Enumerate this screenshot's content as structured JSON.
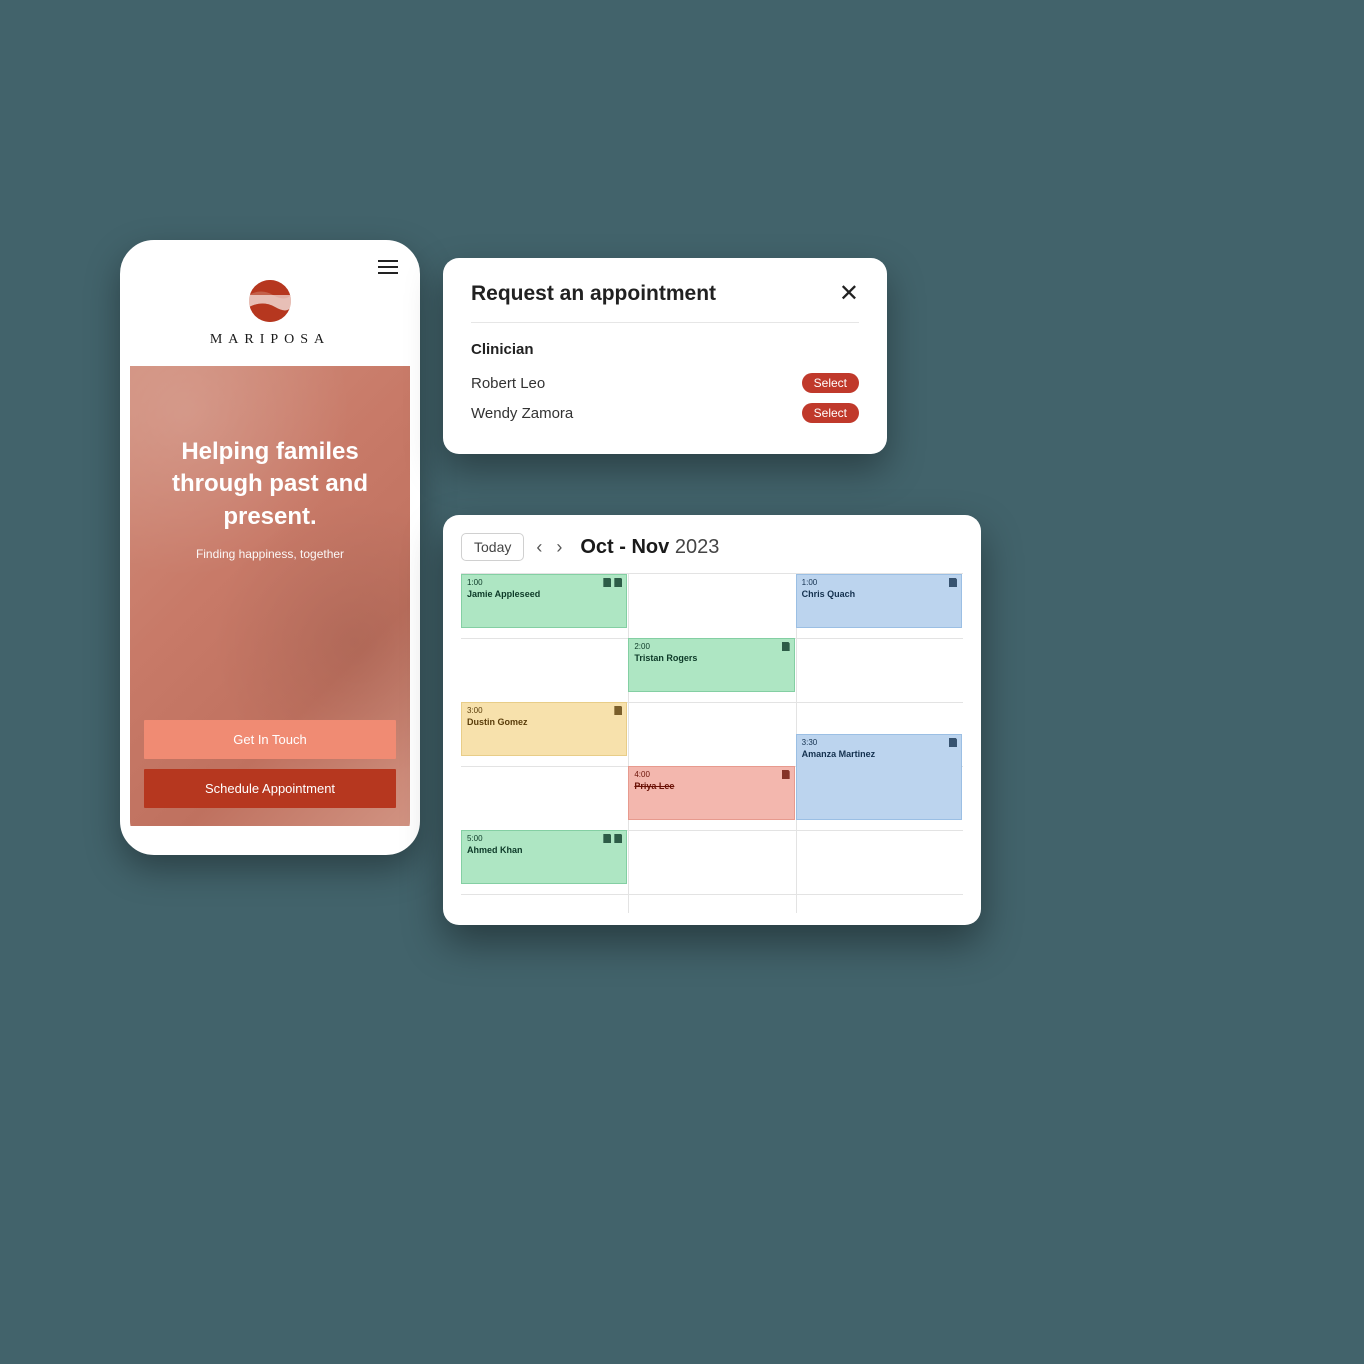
{
  "phone": {
    "brand": "MARIPOSA",
    "hero_title": "Helping familes through past and present.",
    "hero_sub": "Finding happiness, together",
    "btn_touch": "Get In Touch",
    "btn_schedule": "Schedule  Appointment"
  },
  "appointment": {
    "title": "Request an appointment",
    "section_label": "Clinician",
    "clinicians": [
      {
        "name": "Robert Leo",
        "action": "Select"
      },
      {
        "name": "Wendy Zamora",
        "action": "Select"
      }
    ]
  },
  "calendar": {
    "today_label": "Today",
    "range_bold": "Oct - Nov",
    "range_year": "2023",
    "events": [
      {
        "time": "1:00",
        "name": "Jamie Appleseed",
        "color": "green",
        "col": 0,
        "row": 0,
        "span": 1,
        "icons": 2
      },
      {
        "time": "1:00",
        "name": "Chris Quach",
        "color": "blue",
        "col": 2,
        "row": 0,
        "span": 1,
        "icons": 1
      },
      {
        "time": "2:00",
        "name": "Tristan Rogers",
        "color": "green",
        "col": 1,
        "row": 1,
        "span": 1,
        "icons": 1
      },
      {
        "time": "3:00",
        "name": "Dustin Gomez",
        "color": "yellow",
        "col": 0,
        "row": 2,
        "span": 1,
        "icons": 1
      },
      {
        "time": "3:30",
        "name": "Amanza Martinez",
        "color": "blue",
        "col": 2,
        "row": 2.5,
        "span": 1.5,
        "icons": 1
      },
      {
        "time": "4:00",
        "name": "Priya Lee",
        "color": "red",
        "col": 1,
        "row": 3,
        "span": 1,
        "icons": 1
      },
      {
        "time": "5:00",
        "name": "Ahmed Khan",
        "color": "green",
        "col": 0,
        "row": 4,
        "span": 1,
        "icons": 2
      }
    ]
  }
}
